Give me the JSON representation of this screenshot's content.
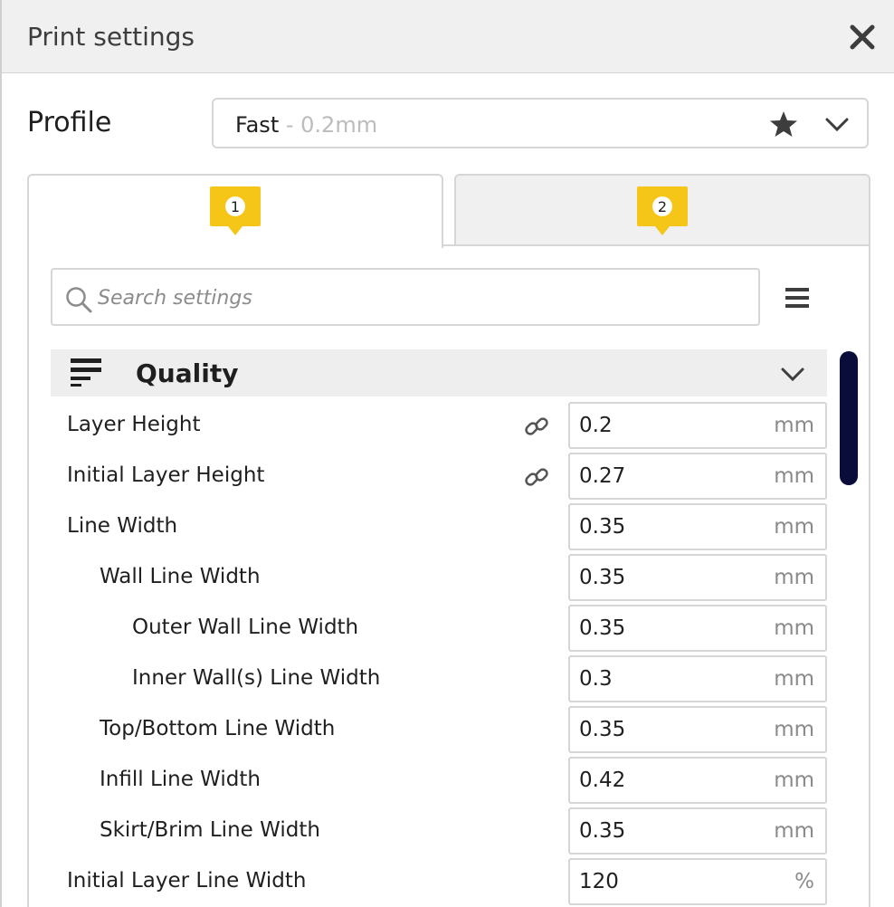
{
  "window": {
    "title": "Print settings"
  },
  "profile": {
    "label": "Profile",
    "name": "Fast",
    "sub": " - 0.2mm"
  },
  "tabs": [
    {
      "badge": "1"
    },
    {
      "badge": "2"
    }
  ],
  "search": {
    "placeholder": "Search settings"
  },
  "section": {
    "title": "Quality"
  },
  "settings": [
    {
      "label": "Layer Height",
      "value": "0.2",
      "unit": "mm",
      "linked": true
    },
    {
      "label": "Initial Layer Height",
      "value": "0.27",
      "unit": "mm",
      "linked": true
    },
    {
      "label": "Line Width",
      "value": "0.35",
      "unit": "mm",
      "linked": false
    },
    {
      "label": "Wall Line Width",
      "value": "0.35",
      "unit": "mm",
      "linked": false
    },
    {
      "label": "Outer Wall Line Width",
      "value": "0.35",
      "unit": "mm",
      "linked": false
    },
    {
      "label": "Inner Wall(s) Line Width",
      "value": "0.3",
      "unit": "mm",
      "linked": false
    },
    {
      "label": "Top/Bottom Line Width",
      "value": "0.35",
      "unit": "mm",
      "linked": false
    },
    {
      "label": "Infill Line Width",
      "value": "0.42",
      "unit": "mm",
      "linked": false
    },
    {
      "label": "Skirt/Brim Line Width",
      "value": "0.35",
      "unit": "mm",
      "linked": false
    },
    {
      "label": "Initial Layer Line Width",
      "value": "120",
      "unit": "%",
      "linked": false
    }
  ],
  "colors": {
    "badge": "#f5c518",
    "scrollbar": "#0a0c3a"
  }
}
